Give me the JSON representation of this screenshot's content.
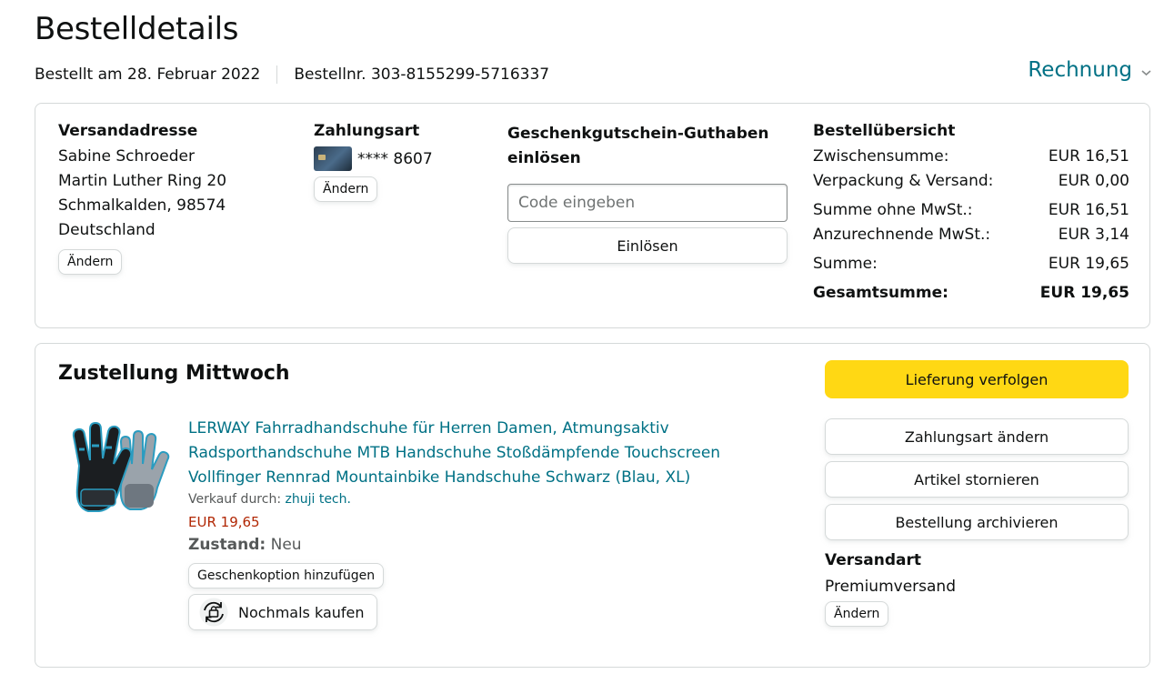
{
  "header": {
    "title": "Bestelldetails",
    "ordered_on": "Bestellt am 28. Februar 2022",
    "order_number": "Bestellnr. 303-8155299-5716337",
    "invoice_label": "Rechnung"
  },
  "shipping_address": {
    "heading": "Versandadresse",
    "lines": [
      "Sabine Schroeder",
      "Martin Luther Ring 20",
      "Schmalkalden, 98574",
      "Deutschland"
    ],
    "change_label": "Ändern"
  },
  "payment": {
    "heading": "Zahlungsart",
    "card_masked": "**** 8607",
    "change_label": "Ändern"
  },
  "gift_card": {
    "heading_line1": "Geschenkgutschein-Guthaben",
    "heading_line2": "einlösen",
    "input_placeholder": "Code eingeben",
    "redeem_label": "Einlösen"
  },
  "order_summary": {
    "heading": "Bestellübersicht",
    "rows": [
      {
        "label": "Zwischensumme:",
        "value": "EUR 16,51"
      },
      {
        "label": "Verpackung & Versand:",
        "value": "EUR 0,00"
      },
      {
        "label": "Summe ohne MwSt.:",
        "value": "EUR 16,51"
      },
      {
        "label": "Anzurechnende MwSt.:",
        "value": "EUR 3,14"
      },
      {
        "label": "Summe:",
        "value": "EUR 19,65"
      },
      {
        "label": "Gesamtsumme:",
        "value": "EUR 19,65"
      }
    ]
  },
  "delivery": {
    "heading": "Zustellung Mittwoch",
    "product": {
      "title": "LERWAY Fahrradhandschuhe für Herren Damen, Atmungsaktiv Radsporthandschuhe MTB Handschuhe Stoßdämpfende Touchscreen Vollfinger Rennrad Mountainbike Handschuhe Schwarz (Blau, XL)",
      "seller_prefix": "Verkauf durch:",
      "seller_name": "zhuji tech.",
      "price": "EUR 19,65",
      "condition_label": "Zustand:",
      "condition_value": "Neu",
      "gift_option_label": "Geschenkoption hinzufügen",
      "buy_again_label": "Nochmals kaufen"
    },
    "actions": {
      "track": "Lieferung verfolgen",
      "change_payment": "Zahlungsart ändern",
      "cancel_items": "Artikel stornieren",
      "archive_order": "Bestellung archivieren"
    },
    "shipping_method": {
      "heading": "Versandart",
      "value": "Premiumversand",
      "change_label": "Ändern"
    }
  },
  "colors": {
    "link": "#007185",
    "price": "#b12704",
    "primary_button": "#ffd814",
    "border": "#d5d9d9"
  }
}
